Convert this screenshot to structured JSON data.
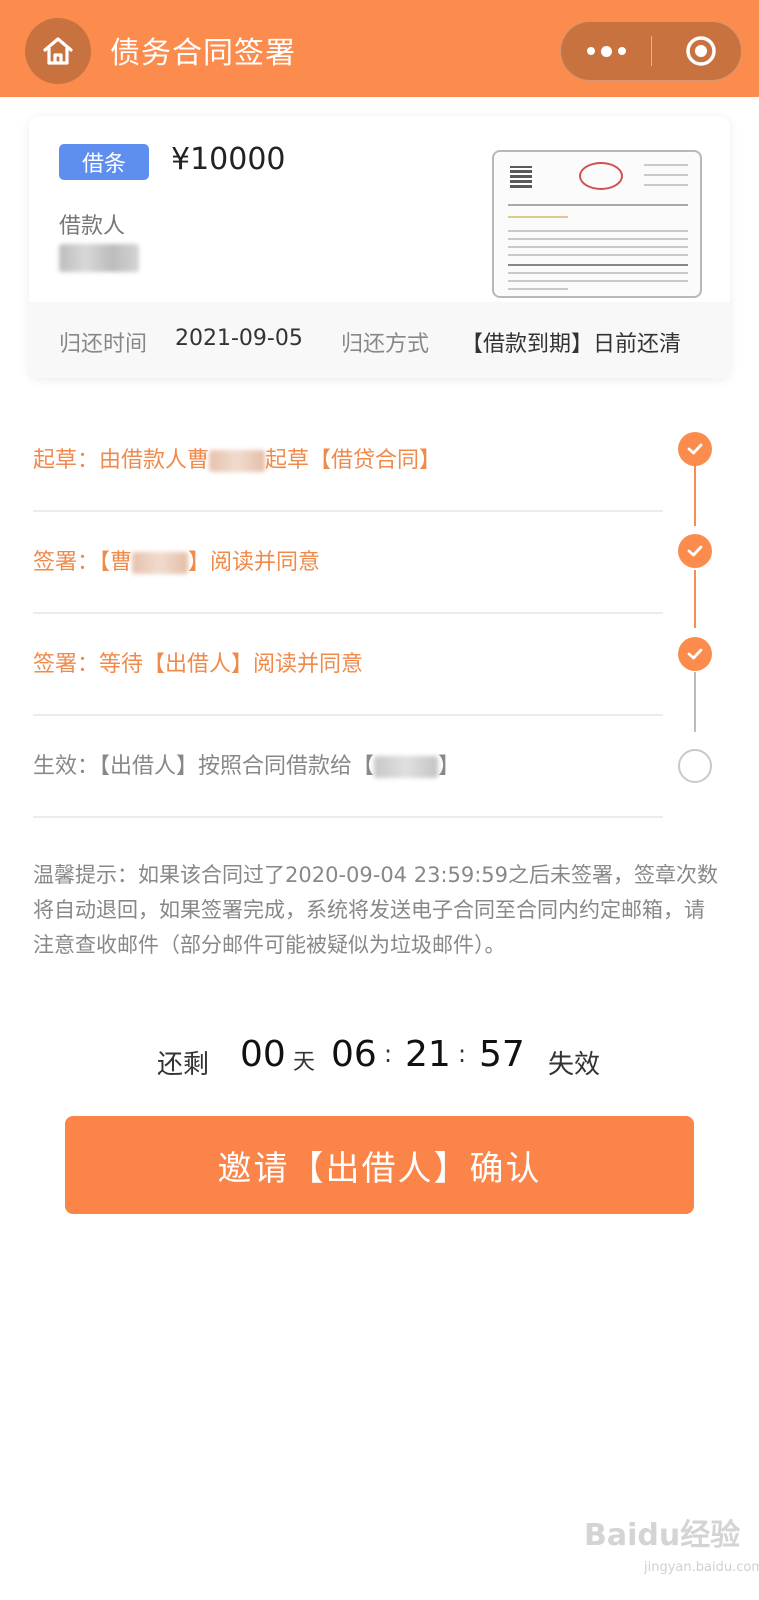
{
  "header": {
    "title": "债务合同签署",
    "home_icon": "home-icon",
    "more_icon": "more-dots-icon",
    "close_icon": "target-circle-icon"
  },
  "card": {
    "badge": "借条",
    "amount": "¥10000",
    "borrower_label": "借款人",
    "return_time_label": "归还时间",
    "return_time_value": "2021-09-05",
    "return_method_label": "归还方式",
    "return_method_value": "【借款到期】日前还清"
  },
  "steps": [
    {
      "prefix": "起草：由借款人曹",
      "suffix": "起草【借贷合同】",
      "status": "done"
    },
    {
      "prefix": "签署：【曹",
      "suffix": "】阅读并同意",
      "status": "done"
    },
    {
      "prefix": "签署：等待【出借人】阅读并同意",
      "suffix": "",
      "status": "done"
    },
    {
      "prefix": "生效：【出借人】按照合同借款给【",
      "suffix": "】",
      "status": "pending"
    }
  ],
  "notice": "温馨提示：如果该合同过了2020-09-04 23:59:59之后未签署，签章次数将自动退回，如果签署完成，系统将发送电子合同至合同内约定邮箱，请注意查收邮件（部分邮件可能被疑似为垃圾邮件）。",
  "countdown": {
    "remain_label": "还剩",
    "days": "00",
    "day_unit": "天",
    "hours": "06",
    "minutes": "21",
    "seconds": "57",
    "colon": ":",
    "expire_label": "失效"
  },
  "invite_button": "邀请【出借人】确认",
  "watermark": {
    "main": "Baidu经验",
    "sub": "jingyan.baidu.com"
  },
  "colors": {
    "brand": "#fb8c4d",
    "badge": "#5e8ef0",
    "button": "#fb8448"
  }
}
